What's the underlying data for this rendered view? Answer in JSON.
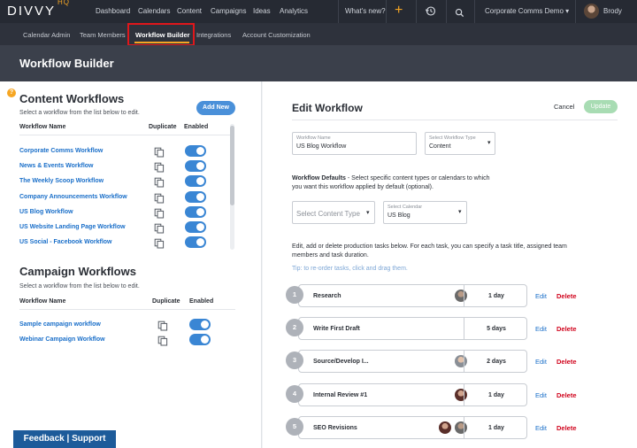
{
  "app": {
    "logo": "DIVVY",
    "logo_suffix": "HQ",
    "nav": [
      "Dashboard",
      "Calendars",
      "Content",
      "Campaigns",
      "Ideas",
      "Analytics"
    ],
    "whats_new": "What's new?",
    "plus": "+",
    "account": "Corporate Comms Demo ▾",
    "user": "Brody"
  },
  "subnav": [
    "Calendar Admin",
    "Team Members",
    "Workflow Builder",
    "Integrations",
    "Account Customization"
  ],
  "page_title": "Workflow Builder",
  "content_workflows": {
    "title": "Content Workflows",
    "subtitle": "Select a workflow from the list below to edit.",
    "add_new": "Add New",
    "headers": {
      "name": "Workflow Name",
      "duplicate": "Duplicate",
      "enabled": "Enabled"
    },
    "items": [
      {
        "name": "Corporate Comms Workflow",
        "enabled": true
      },
      {
        "name": "News & Events Workflow",
        "enabled": true
      },
      {
        "name": "The Weekly Scoop Workflow",
        "enabled": true
      },
      {
        "name": "Company Announcements Workflow",
        "enabled": true
      },
      {
        "name": "US Blog Workflow",
        "enabled": true
      },
      {
        "name": "US Website Landing Page Workflow",
        "enabled": true
      },
      {
        "name": "US Social - Facebook Workflow",
        "enabled": true
      }
    ]
  },
  "campaign_workflows": {
    "title": "Campaign Workflows",
    "subtitle": "Select a workflow from the list below to edit.",
    "headers": {
      "name": "Workflow Name",
      "duplicate": "Duplicate",
      "enabled": "Enabled"
    },
    "items": [
      {
        "name": "Sample campaign workflow",
        "enabled": true
      },
      {
        "name": "Webinar Campaign Workflow",
        "enabled": true
      }
    ]
  },
  "feedback": "Feedback | Support",
  "edit_workflow": {
    "title": "Edit Workflow",
    "cancel": "Cancel",
    "update": "Update",
    "workflow_name": {
      "label": "Workflow Name",
      "value": "US Blog Workflow"
    },
    "workflow_type": {
      "label": "Select Workflow Type",
      "value": "Content"
    },
    "defaults_bold": "Workflow Defaults",
    "defaults_text": " - Select specific content types or calendars to which",
    "defaults_text2": "you want this workflow applied by default (optional).",
    "content_type_placeholder": "Select Content Type",
    "calendar": {
      "label": "Select Calendar",
      "value": "US Blog"
    },
    "tasks_intro1": "Edit, add or delete production tasks below. For each task, you can specify a task title, assigned team",
    "tasks_intro2": "members and task duration.",
    "tip": "Tip: to re-order tasks, click and drag them.",
    "edit_label": "Edit",
    "delete_label": "Delete",
    "tasks": [
      {
        "num": "1",
        "name": "Research",
        "duration": "1 day",
        "avatars": [
          "av-a"
        ]
      },
      {
        "num": "2",
        "name": "Write First Draft",
        "duration": "5 days",
        "avatars": []
      },
      {
        "num": "3",
        "name": "Source/Develop I...",
        "duration": "2 days",
        "avatars": [
          "av-b"
        ]
      },
      {
        "num": "4",
        "name": "Internal Review #1",
        "duration": "1 day",
        "avatars": [
          "av-c"
        ]
      },
      {
        "num": "5",
        "name": "SEO Revisions",
        "duration": "1 day",
        "avatars": [
          "av-c",
          "av-a"
        ]
      }
    ]
  },
  "colors": {
    "accent": "#f6a623",
    "link": "#1a6fc9",
    "delete": "#d0021b",
    "toggle": "#3a86d4",
    "update": "#a8dcb3"
  }
}
